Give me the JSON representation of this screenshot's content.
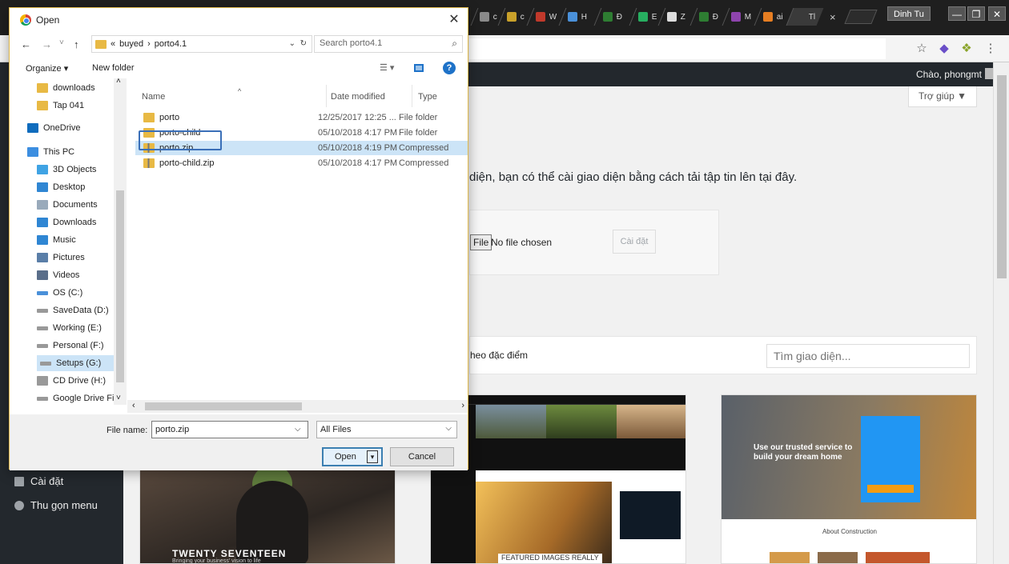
{
  "browser": {
    "tabs": [
      {
        "label": "c",
        "color": "#8a8a8a"
      },
      {
        "label": "c",
        "color": "#c9a12a"
      },
      {
        "label": "W",
        "color": "#c0392b"
      },
      {
        "label": "H",
        "color": "#4a90d9"
      },
      {
        "label": "Đ",
        "color": "#2e7d32"
      },
      {
        "label": "E",
        "color": "#27ae60"
      },
      {
        "label": "Z",
        "color": "#dddddd"
      },
      {
        "label": "Đ",
        "color": "#2e7d32"
      },
      {
        "label": "M",
        "color": "#8e44ad"
      },
      {
        "label": "ai",
        "color": "#e67e22"
      },
      {
        "label": "Tl",
        "color": "#3a3a3a"
      }
    ],
    "tab_close": "×",
    "user": "Dinh Tu",
    "window_controls": {
      "minimize": "—",
      "maximize": "❐",
      "close": "✕"
    },
    "star_icon": "☆"
  },
  "wp": {
    "greeting": "Chào, phongmt",
    "help": "Trợ giúp ▼",
    "upload_text": "diện, bạn có thể cài giao diện bằng cách tải tập tin lên tại đây.",
    "file_button": "File",
    "no_file": "No file chosen",
    "install": "Cài đặt",
    "filter_text": "heo đặc điểm",
    "search_placeholder": "Tìm giao diện...",
    "sidebar": [
      {
        "label": "Cài đặt"
      },
      {
        "label": "Thu gọn menu"
      }
    ],
    "themes": {
      "seventeen_name": "TWENTY SEVENTEEN",
      "seventeen_tag": "Bringing your business' vision to life",
      "mid_caption": "FEATURED IMAGES REALLY",
      "cons_hero": "Use our trusted service to build your dream home",
      "cons_about": "About Construction"
    }
  },
  "dialog": {
    "title": "Open",
    "close": "✕",
    "nav": {
      "back": "←",
      "forward": "→",
      "recent": "˅",
      "up": "↑"
    },
    "breadcrumb": {
      "prefix": "«",
      "parts": [
        "buyed",
        "›",
        "porto4.1"
      ],
      "chevron": "⌄",
      "refresh": "↻"
    },
    "search_placeholder": "Search porto4.1",
    "search_icon": "⌕",
    "organize": "Organize ▾",
    "new_folder": "New folder",
    "view_icon": "☰ ▾",
    "help_icon": "?",
    "nav_items": [
      {
        "label": "downloads",
        "icon": "folder",
        "color": "#e8b944"
      },
      {
        "label": "Tap 041",
        "icon": "folder",
        "color": "#e8b944"
      },
      {
        "label": "OneDrive",
        "icon": "cloud",
        "color": "#0f6cbd"
      },
      {
        "label": "This PC",
        "icon": "pc",
        "color": "#3c8ee0"
      },
      {
        "label": "3D Objects",
        "icon": "cube",
        "color": "#3fa3e4"
      },
      {
        "label": "Desktop",
        "icon": "desktop",
        "color": "#2f86d3"
      },
      {
        "label": "Documents",
        "icon": "document",
        "color": "#9ab"
      },
      {
        "label": "Downloads",
        "icon": "download",
        "color": "#2f86d3"
      },
      {
        "label": "Music",
        "icon": "music",
        "color": "#2f86d3"
      },
      {
        "label": "Pictures",
        "icon": "picture",
        "color": "#5a7ea8"
      },
      {
        "label": "Videos",
        "icon": "video",
        "color": "#5a6e8a"
      },
      {
        "label": "OS (C:)",
        "icon": "drive",
        "color": "#4a90d9"
      },
      {
        "label": "SaveData (D:)",
        "icon": "drive",
        "color": "#999"
      },
      {
        "label": "Working (E:)",
        "icon": "drive",
        "color": "#999"
      },
      {
        "label": "Personal (F:)",
        "icon": "drive",
        "color": "#999"
      },
      {
        "label": "Setups (G:)",
        "icon": "drive",
        "color": "#999"
      },
      {
        "label": "CD Drive (H:)",
        "icon": "cd",
        "color": "#999"
      },
      {
        "label": "Google Drive File",
        "icon": "drive",
        "color": "#999"
      }
    ],
    "columns": {
      "name": "Name",
      "date": "Date modified",
      "type": "Type",
      "sort_indicator": "^"
    },
    "files": [
      {
        "name": "porto",
        "date": "12/25/2017 12:25 ...",
        "type": "File folder",
        "kind": "folder"
      },
      {
        "name": "porto-child",
        "date": "05/10/2018 4:17 PM",
        "type": "File folder",
        "kind": "folder"
      },
      {
        "name": "porto.zip",
        "date": "05/10/2018 4:19 PM",
        "type": "Compressed",
        "kind": "zip"
      },
      {
        "name": "porto-child.zip",
        "date": "05/10/2018 4:17 PM",
        "type": "Compressed",
        "kind": "zip"
      }
    ],
    "file_name_label": "File name:",
    "file_name_value": "porto.zip",
    "file_type": "All Files",
    "chevron": "⌵",
    "open": "Open",
    "open_split": "▾",
    "cancel": "Cancel",
    "scroll_left": "‹",
    "scroll_right": "›",
    "scroll_down": "˅",
    "scroll_up": "˄"
  }
}
